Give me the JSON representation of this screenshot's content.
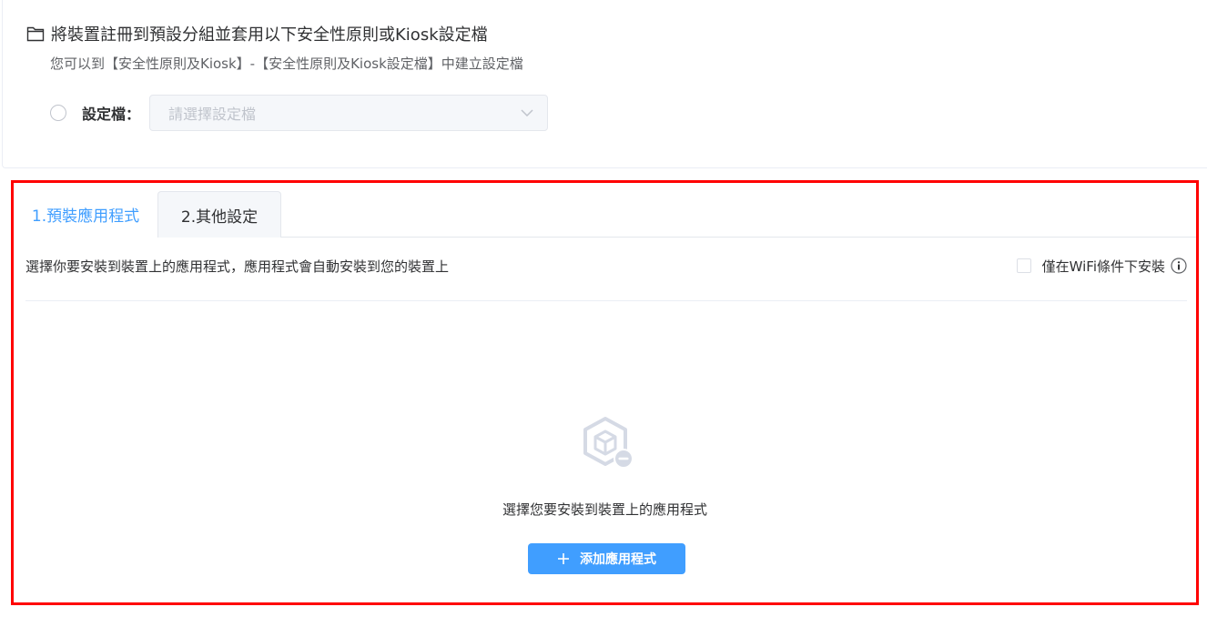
{
  "profile_section": {
    "title": "將裝置註冊到預設分組並套用以下安全性原則或Kiosk設定檔",
    "subtitle": "您可以到【安全性原則及Kiosk】-【安全性原則及Kiosk設定檔】中建立設定檔",
    "profile_label": "設定檔：",
    "select_placeholder": "請選擇設定檔",
    "folder_icon": "folder-icon",
    "chevron_icon": "chevron-down-icon"
  },
  "tabs": [
    {
      "label": "1.預裝應用程式",
      "active": true
    },
    {
      "label": "2.其他設定",
      "active": false
    }
  ],
  "preinstall": {
    "description": "選擇你要安裝到裝置上的應用程式，應用程式會自動安裝到您的裝置上",
    "wifi_only_label": "僅在WiFi條件下安裝",
    "wifi_only_checked": false,
    "info_icon": "info-icon",
    "empty_state_icon": "app-package-icon",
    "empty_text": "選擇您要安裝到裝置上的應用程式",
    "add_button_label": "添加應用程式",
    "add_button_icon": "plus-icon"
  },
  "colors": {
    "primary": "#409eff",
    "highlight_border": "#ff0000",
    "text": "#303133",
    "muted": "#606266",
    "placeholder": "#c0c4cc"
  }
}
